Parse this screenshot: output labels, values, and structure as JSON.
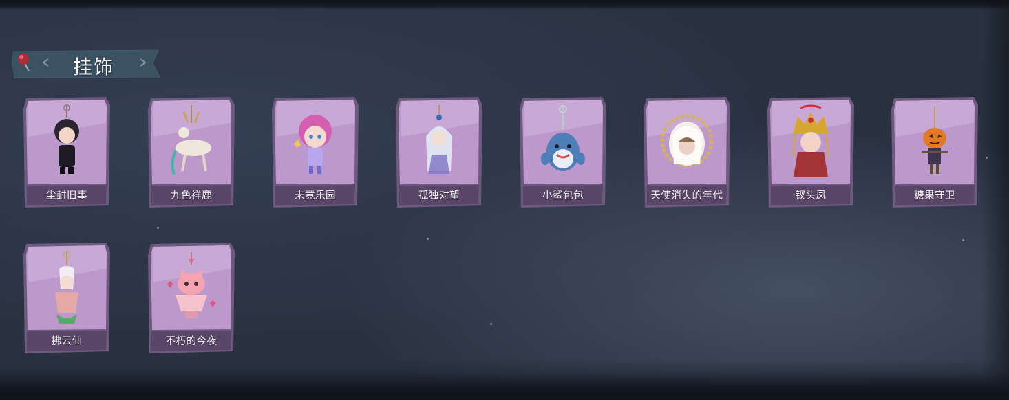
{
  "section": {
    "title": "挂饰"
  },
  "items": [
    {
      "name": "尘封旧事",
      "icon": "chibi-gentleman-charm-icon"
    },
    {
      "name": "九色祥鹿",
      "icon": "deer-charm-icon"
    },
    {
      "name": "未竟乐园",
      "icon": "pink-hair-girl-charm-icon"
    },
    {
      "name": "孤独对望",
      "icon": "white-hair-figure-charm-icon"
    },
    {
      "name": "小鲨包包",
      "icon": "shark-charm-icon"
    },
    {
      "name": "天使消失的年代",
      "icon": "angel-portrait-charm-icon"
    },
    {
      "name": "钗头凤",
      "icon": "phoenix-crown-charm-icon"
    },
    {
      "name": "糖果守卫",
      "icon": "pumpkin-scarecrow-charm-icon"
    },
    {
      "name": "拂云仙",
      "icon": "cloud-fairy-charm-icon"
    },
    {
      "name": "不朽的今夜",
      "icon": "pink-cat-cup-charm-icon"
    }
  ],
  "colors": {
    "background": "#283040",
    "card_purple": "#b992c9",
    "card_border": "#6e5a7e",
    "label_bar": "#5a4668",
    "title_tag": "#3d5566"
  }
}
